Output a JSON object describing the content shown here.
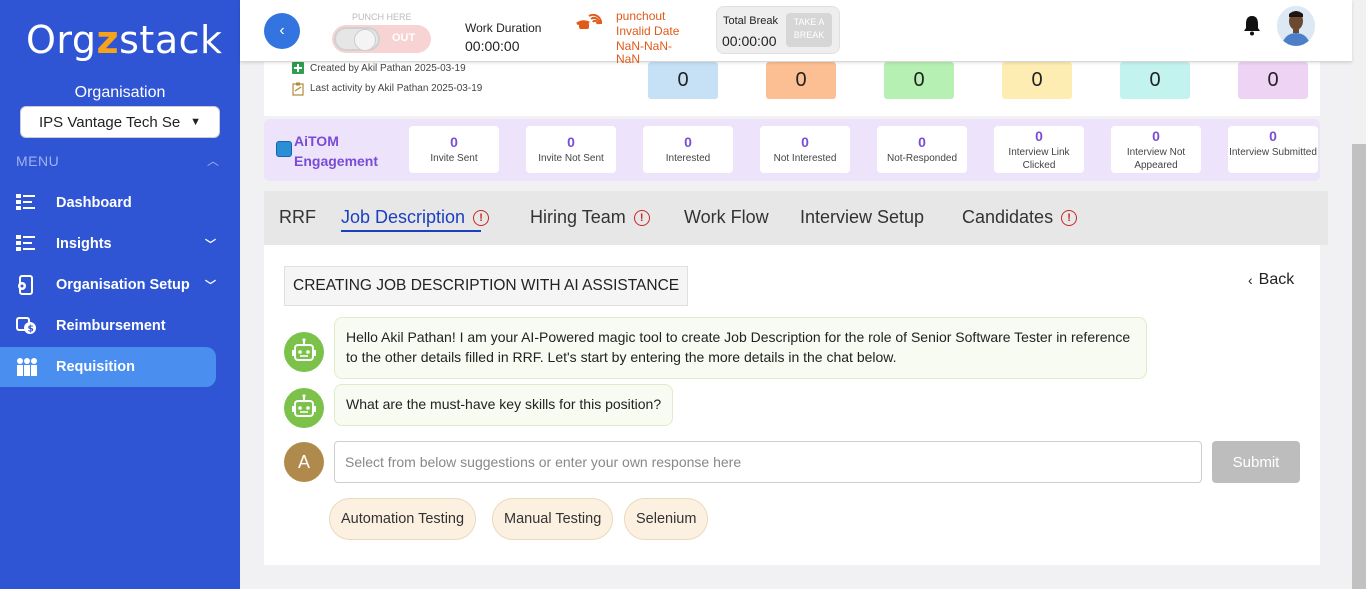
{
  "sidebar": {
    "logo": {
      "part1": "Org",
      "part2": "z",
      "part3": "stack"
    },
    "org_label": "Organisation",
    "org_selected": "IPS Vantage Tech Se",
    "menu_label": "MENU",
    "items": [
      {
        "label": "Dashboard",
        "icon": "dashboard-list-icon"
      },
      {
        "label": "Insights",
        "icon": "insights-list-icon"
      },
      {
        "label": "Organisation Setup",
        "icon": "org-setup-icon"
      },
      {
        "label": "Reimbursement",
        "icon": "reimbursement-icon"
      },
      {
        "label": "Requisition",
        "icon": "requisition-people-icon",
        "active": true
      }
    ]
  },
  "header": {
    "back_glyph": "‹",
    "punch_label": "PUNCH HERE",
    "punch_toggle_text": "OUT",
    "work_duration_label": "Work Duration",
    "work_duration_value": "00:00:00",
    "punchout_line1": "punchout",
    "punchout_line2": "Invalid Date",
    "punchout_line3": "NaN-NaN-",
    "punchout_line4": "NaN",
    "break_label": "Total Break",
    "break_value": "00:00:00",
    "break_button": "TAKE A BREAK"
  },
  "summary": {
    "created_by": "Created by Akil Pathan 2025-03-19",
    "last_activity": "Last activity by Akil Pathan 2025-03-19",
    "stats": [
      "0",
      "0",
      "0",
      "0",
      "0",
      "0"
    ],
    "stat_colors": [
      "#c6e0f5",
      "#fcbf94",
      "#b6f0b2",
      "#fdedb3",
      "#c3f3ef",
      "#efd3f4"
    ]
  },
  "aitom": {
    "title_line1": "AiTOM",
    "title_line2": "Engagement",
    "cards": [
      {
        "value": "0",
        "label": "Invite Sent"
      },
      {
        "value": "0",
        "label": "Invite Not Sent"
      },
      {
        "value": "0",
        "label": "Interested"
      },
      {
        "value": "0",
        "label": "Not Interested"
      },
      {
        "value": "0",
        "label": "Not-Responded"
      },
      {
        "value": "0",
        "label": "Interview Link Clicked"
      },
      {
        "value": "0",
        "label": "Interview Not Appeared"
      },
      {
        "value": "0",
        "label": "Interview Submitted"
      }
    ]
  },
  "tabs": [
    {
      "label": "RRF"
    },
    {
      "label": "Job Description",
      "active": true,
      "alert": true
    },
    {
      "label": "Hiring Team",
      "alert": true
    },
    {
      "label": "Work Flow"
    },
    {
      "label": "Interview Setup"
    },
    {
      "label": "Candidates",
      "alert": true
    }
  ],
  "jd": {
    "heading": "CREATING JOB DESCRIPTION WITH AI ASSISTANCE",
    "back": "Back",
    "bot_message_1": "Hello Akil Pathan! I am your AI-Powered magic tool to create Job Description for the role of Senior Software Tester in reference to the other details filled in RRF. Let's start by entering the more details in the chat below.",
    "bot_message_2": "What are the must-have key skills for this position?",
    "user_initial": "A",
    "input_placeholder": "Select from below suggestions or enter your own response here",
    "submit": "Submit",
    "suggestions": [
      "Automation Testing",
      "Manual Testing",
      "Selenium"
    ]
  }
}
